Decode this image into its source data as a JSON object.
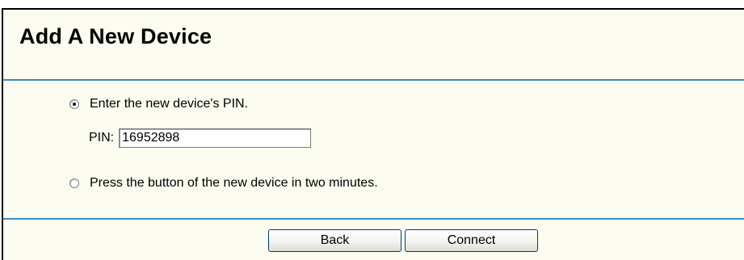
{
  "page": {
    "title": "Add A New Device"
  },
  "options": {
    "pin_option_label": "Enter the new device's PIN.",
    "pin_option_selected": true,
    "pin_field_label": "PIN:",
    "pin_value": "16952898",
    "push_option_label": "Press the button of the new device in two minutes.",
    "push_option_selected": false
  },
  "buttons": {
    "back_label": "Back",
    "connect_label": "Connect"
  },
  "colors": {
    "panel_background": "#fcfcf1",
    "divider": "#3c8bc4",
    "border": "#000000"
  }
}
